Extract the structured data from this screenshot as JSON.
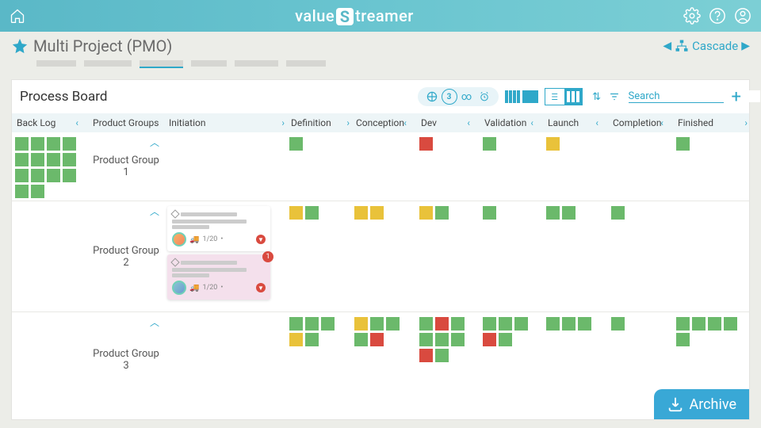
{
  "brand_left": "value",
  "brand_right": "treamer",
  "page_title": "Multi Project (PMO)",
  "cascade_label": "Cascade",
  "board_title": "Process Board",
  "search_placeholder": "Search",
  "toolbar_count": "3",
  "archive_label": "Archive",
  "columns": {
    "backlog": "Back Log",
    "product_groups": "Product Groups",
    "initiation": "Initiation",
    "definition": "Definition",
    "conception": "Conception",
    "dev": "Dev",
    "validation": "Validation",
    "launch": "Launch",
    "completion": "Completion",
    "finished": "Finished"
  },
  "groups": {
    "g1": "Product Group 1",
    "g2": "Product Group 2",
    "g3": "Product Group 3"
  },
  "card": {
    "date": "1/20",
    "badge": "1"
  },
  "backlog_tiles": [
    "g",
    "g",
    "g",
    "g",
    "g",
    "g",
    "g",
    "g",
    "g",
    "g",
    "g",
    "g",
    "g",
    "g"
  ],
  "lanes": {
    "g1": {
      "initiation": [],
      "definition": [
        "g"
      ],
      "conception": [],
      "dev": [
        "r"
      ],
      "validation": [
        "g"
      ],
      "launch": [
        "y"
      ],
      "completion": [],
      "finished": [
        "g"
      ]
    },
    "g2": {
      "initiation": [],
      "definition": [
        "y",
        "g"
      ],
      "conception": [
        "y",
        "y"
      ],
      "dev": [
        "y",
        "g"
      ],
      "validation": [
        "g"
      ],
      "launch": [
        "g",
        "g"
      ],
      "completion": [
        "g"
      ],
      "finished": []
    },
    "g3": {
      "initiation": [],
      "definition": [
        "g",
        "g",
        "g",
        "y",
        "g"
      ],
      "conception": [
        "y",
        "g",
        "g",
        "g",
        "r"
      ],
      "dev": [
        "g",
        "r",
        "g",
        "g",
        "g",
        "g",
        "r",
        "g"
      ],
      "validation": [
        "g",
        "g",
        "g",
        "r",
        "g"
      ],
      "launch": [
        "g",
        "g",
        "g"
      ],
      "completion": [
        "g"
      ],
      "finished": [
        "g",
        "g",
        "g",
        "g",
        "g"
      ]
    }
  }
}
